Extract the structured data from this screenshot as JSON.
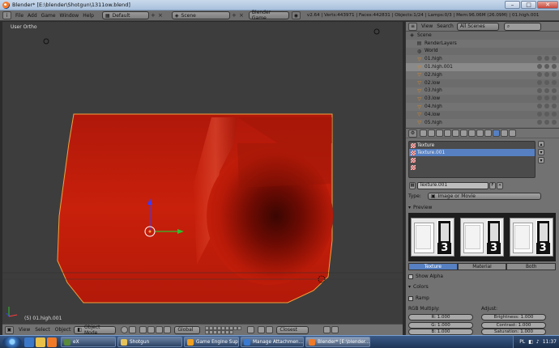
{
  "window": {
    "title": "Blender* [E:\\blender\\Shotgun\\1311ow.blend]",
    "min": "–",
    "max": "□",
    "close": "✕"
  },
  "info_header": {
    "menus": [
      "File",
      "Add",
      "Game",
      "Window",
      "Help"
    ],
    "layout": "Default",
    "scene": "Scene",
    "engine": "Blender Game",
    "stats": "v2.64 | Verts:443971 | Faces:442831 | Objects:1/24 | Lamps:0/3 | Mem:96.06M (26.09M) | 01.high.001"
  },
  "viewport": {
    "view_label": "User Ortho",
    "object_label": "(5) 01.high.001",
    "colors": {
      "mesh": "#c8200b",
      "mesh_dark": "#6b0a02",
      "bg": "#3d3d3d",
      "outline": "#f4a13a"
    }
  },
  "viewport_header": {
    "view": "View",
    "select": "Select",
    "object": "Object",
    "mode": "Object Mode",
    "orientation": "Global",
    "snap": "Closest"
  },
  "outliner": {
    "header": {
      "view": "View",
      "search": "Search",
      "filter": "All Scenes"
    },
    "rows": [
      {
        "label": "Scene",
        "icon": "scene-icon",
        "indent": 0
      },
      {
        "label": "RenderLayers",
        "icon": "renderlayers-icon",
        "indent": 1
      },
      {
        "label": "World",
        "icon": "world-icon",
        "indent": 1
      },
      {
        "label": "01.high",
        "icon": "mesh-icon",
        "indent": 1
      },
      {
        "label": "01.high.001",
        "icon": "mesh-icon",
        "indent": 1
      },
      {
        "label": "02.high",
        "icon": "mesh-icon",
        "indent": 1
      },
      {
        "label": "02.low",
        "icon": "mesh-icon",
        "indent": 1
      },
      {
        "label": "03.high",
        "icon": "mesh-icon",
        "indent": 1
      },
      {
        "label": "03.low",
        "icon": "mesh-icon",
        "indent": 1
      },
      {
        "label": "04.high",
        "icon": "mesh-icon",
        "indent": 1
      },
      {
        "label": "04.low",
        "icon": "mesh-icon",
        "indent": 1
      },
      {
        "label": "05.high",
        "icon": "mesh-icon",
        "indent": 1
      }
    ]
  },
  "properties": {
    "slots": [
      "Texture",
      "Texture.001",
      "",
      ""
    ],
    "selected_slot": 1,
    "texture_name": "Texture.001",
    "fake_user": "F",
    "type_label": "Type:",
    "type_value": "Image or Movie",
    "preview_label": "Preview",
    "preview_tabs": [
      "Texture",
      "Material",
      "Both"
    ],
    "active_preview_tab": 0,
    "show_alpha": "Show Alpha",
    "colors_label": "Colors",
    "ramp_label": "Ramp",
    "rgb_multiply": "RGB Multiply:",
    "adjust": "Adjust:",
    "r": "R: 1.000",
    "g": "G: 1.000",
    "b": "B: 1.000",
    "brightness": "Brightness: 1.000",
    "contrast": "Contrast: 1.000",
    "saturation": "Saturation: 1.000"
  },
  "taskbar": {
    "items": [
      {
        "label": "eX",
        "color": "#5a8a3a"
      },
      {
        "label": "Shotgun",
        "color": "#e6c35a"
      },
      {
        "label": "Game Engine Suppo...",
        "color": "#f0a020"
      },
      {
        "label": "Manage Attachmen...",
        "color": "#3a7ad0"
      },
      {
        "label": "Blender* [E:\\blender...",
        "color": "#f07a28"
      }
    ],
    "active": 4,
    "tray_lang": "PL",
    "clock": "11:37"
  }
}
